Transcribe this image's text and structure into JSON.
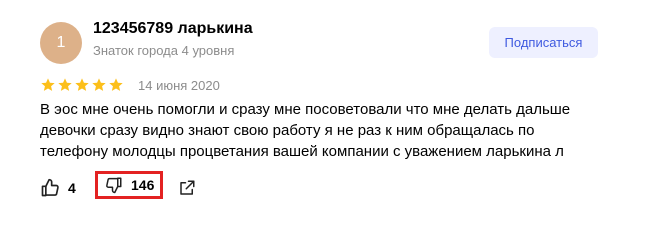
{
  "author": {
    "avatar_initial": "1",
    "avatar_color": "#ddb189",
    "name": "123456789 ларькина",
    "level": "Знаток города 4 уровня"
  },
  "subscribe_label": "Подписаться",
  "rating": {
    "stars": 5,
    "max_stars": 5,
    "star_color": "#fcbf1a",
    "date": "14 июня 2020"
  },
  "review": {
    "lines": [
      "В эос мне очень помогли и сразу мне посоветовали что мне делать дальше",
      "девочки сразу видно знают свою работу я не раз к ним обращалась по",
      "телефону молодцы процветания вашей компании с уважением ларькина л"
    ]
  },
  "actions": {
    "likes": "4",
    "dislikes": "146",
    "highlight_color": "#e32222"
  }
}
